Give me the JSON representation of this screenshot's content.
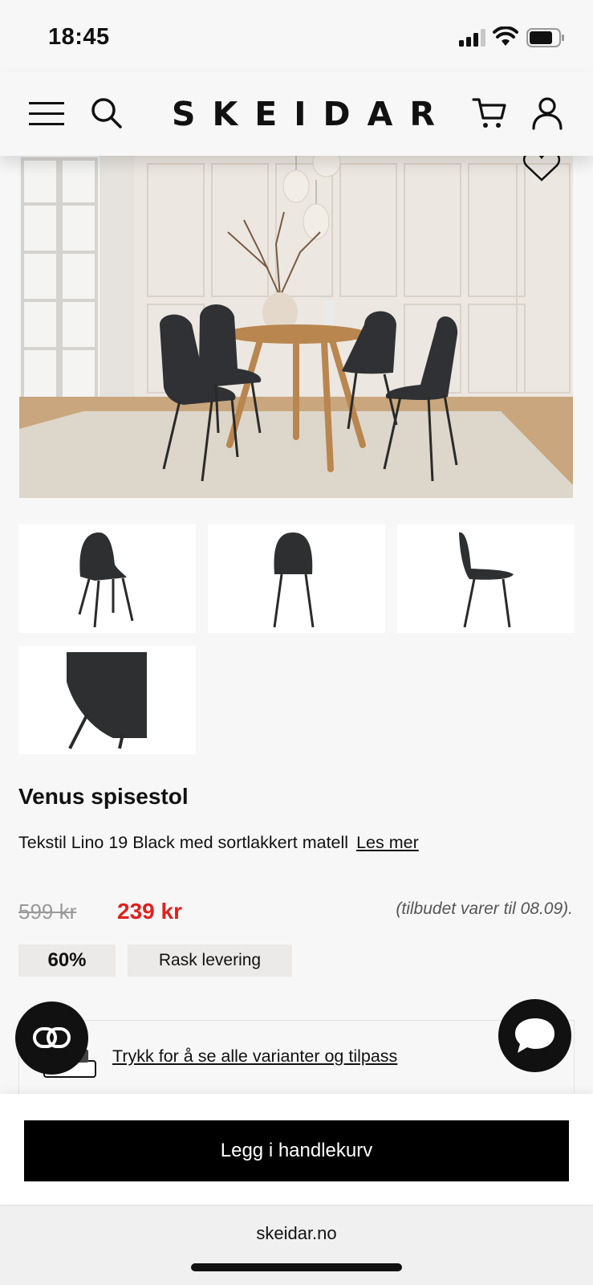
{
  "status_bar": {
    "time": "18:45"
  },
  "header": {
    "logo": "SKEIDAR"
  },
  "product": {
    "name": "Venus spisestol",
    "description": "Tekstil Lino 19 Black med sortlakkert matell",
    "read_more": "Les mer",
    "old_price": "599 kr",
    "new_price": "239 kr",
    "offer_note": "(tilbudet varer til 08.09).",
    "badges": {
      "discount": "60%",
      "delivery": "Rask levering"
    }
  },
  "variants_link": "Trykk for å se alle varianter og tilpass",
  "add_to_cart": "Legg i handlekurv",
  "browser": {
    "url": "skeidar.no"
  },
  "colors": {
    "price_red": "#e0211f",
    "badge_bg": "#ebeae8",
    "button_bg": "#000000"
  },
  "icons": [
    "menu-icon",
    "search-icon",
    "cart-icon",
    "user-icon",
    "heart-icon",
    "compare-icon",
    "chat-icon"
  ]
}
